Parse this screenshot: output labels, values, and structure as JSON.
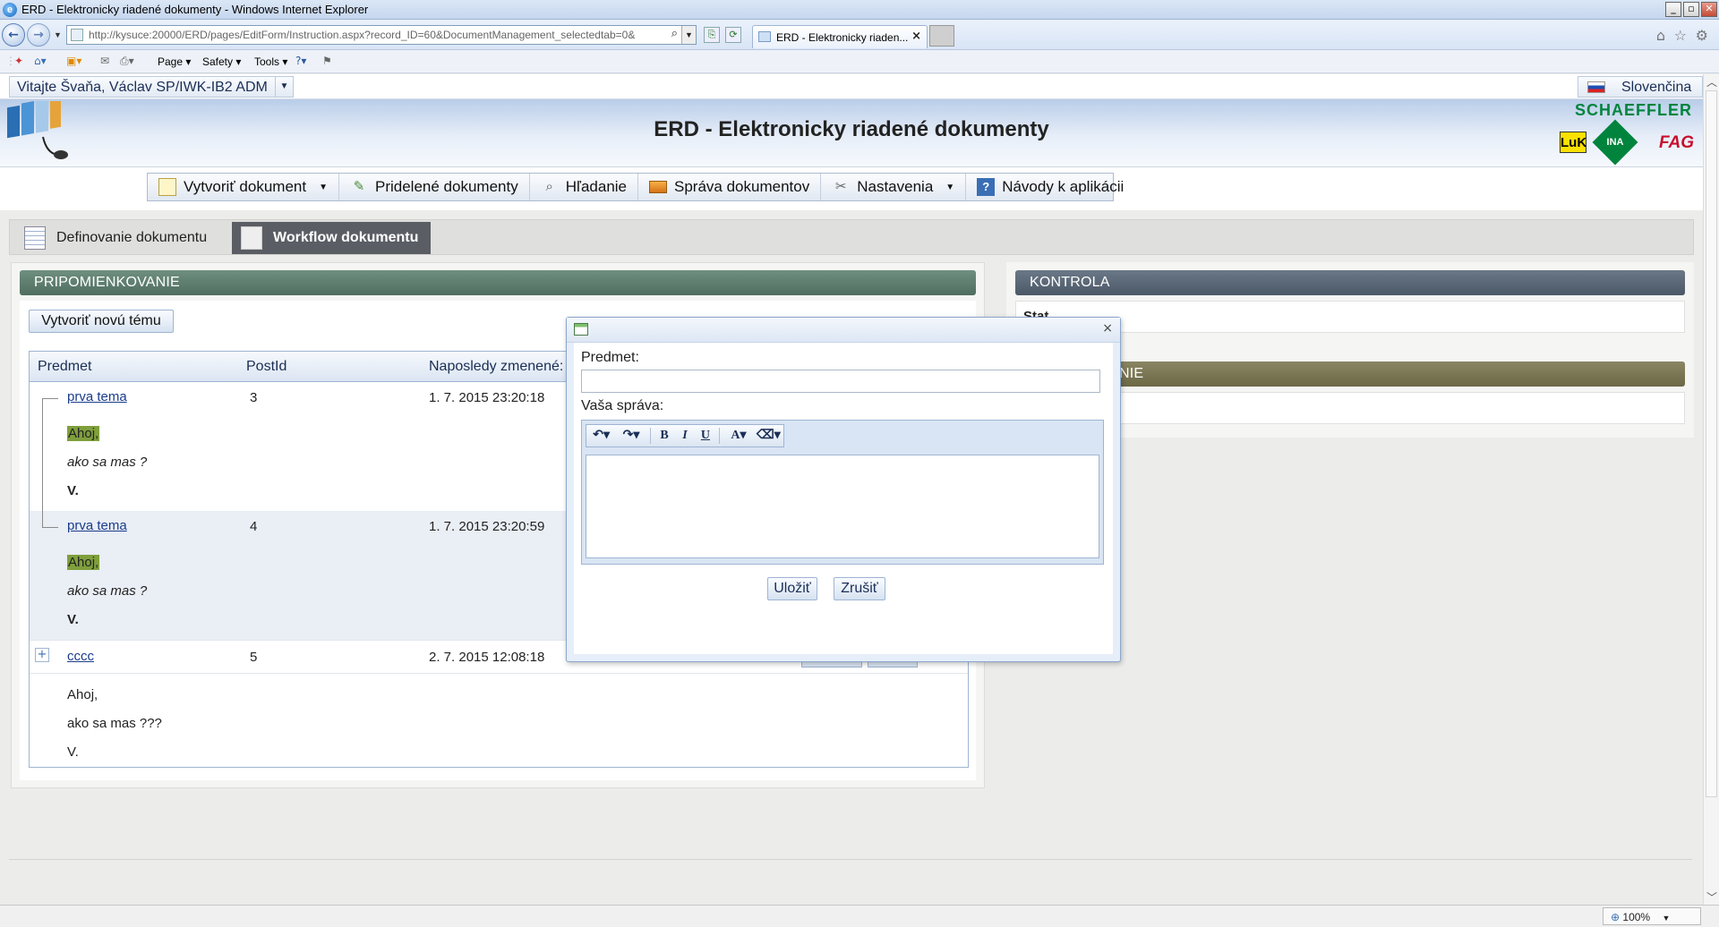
{
  "browser": {
    "window_title": "ERD - Elektronicky riadené dokumenty - Windows Internet Explorer",
    "url": "http://kysuce:20000/ERD/pages/EditForm/Instruction.aspx?record_ID=60&DocumentManagement_selectedtab=0&",
    "tab_label": "ERD - Elektronicky riaden...",
    "command_bar": {
      "page": "Page",
      "safety": "Safety",
      "tools": "Tools"
    },
    "zoom": "100%"
  },
  "userbar": {
    "welcome": "Vitajte Švaňa, Václav SP/IWK-IB2 ADM",
    "language": "Slovenčina"
  },
  "header": {
    "app_title": "ERD - Elektronicky riadené dokumenty",
    "brand_schaeffler": "SCHAEFFLER",
    "brand_luk": "LuK",
    "brand_ina": "INA",
    "brand_fag": "FAG"
  },
  "nav": [
    {
      "label": "Vytvoriť dokument",
      "icon": "new-document-icon",
      "has_dropdown": true
    },
    {
      "label": "Pridelené dokumenty",
      "icon": "assigned-documents-icon",
      "has_dropdown": false
    },
    {
      "label": "Hľadanie",
      "icon": "search-icon",
      "has_dropdown": false
    },
    {
      "label": "Správa dokumentov",
      "icon": "folder-icon",
      "has_dropdown": false
    },
    {
      "label": "Nastavenia",
      "icon": "tools-icon",
      "has_dropdown": true
    },
    {
      "label": "Návody k aplikácii",
      "icon": "help-book-icon",
      "has_dropdown": false
    }
  ],
  "doc_tabs": [
    {
      "label": "Definovanie dokumentu",
      "active": false
    },
    {
      "label": "Workflow dokumentu",
      "active": true
    }
  ],
  "left_section": {
    "title": "PRIPOMIENKOVANIE",
    "new_topic_button": "Vytvoriť novú tému",
    "columns": [
      "Predmet",
      "PostId",
      "Naposledy zmenené:"
    ],
    "rows": [
      {
        "subject": "prva tema",
        "post_id": "3",
        "modified": "1. 7. 2015 23:20:18",
        "body": [
          "Ahoj,",
          "ako sa mas ?",
          "V."
        ]
      },
      {
        "subject": "prva tema",
        "post_id": "4",
        "modified": "1. 7. 2015 23:20:59",
        "body": [
          "Ahoj,",
          "ako sa mas ?",
          "V."
        ]
      },
      {
        "subject": "cccc",
        "post_id": "5",
        "modified": "2. 7. 2015 12:08:18",
        "body": [
          "Ahoj,",
          "ako  sa mas ???",
          "V."
        ]
      }
    ]
  },
  "right_sections": {
    "kontrola_title": "KONTROLA",
    "kontrola_text": "Stat",
    "second_title_visible": "NIE"
  },
  "dialog": {
    "subject_label": "Predmet:",
    "subject_value": "",
    "message_label": "Vaša správa:",
    "message_value": "",
    "toolbar": {
      "undo": "↶",
      "redo": "↷",
      "bold": "B",
      "italic": "I",
      "underline": "U",
      "font_color": "A",
      "format": "⌫"
    },
    "save_button": "Uložiť",
    "cancel_button": "Zrušiť"
  }
}
